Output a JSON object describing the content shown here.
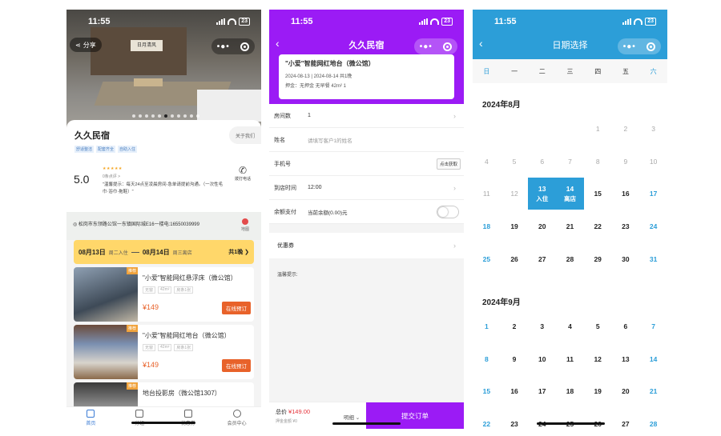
{
  "status": {
    "time": "11:55",
    "battery": "23"
  },
  "screen1": {
    "share_label": "分享",
    "hero_sign": "日月清风",
    "hotel_name": "久久民宿",
    "tags": [
      "舒适整洁",
      "配套齐全",
      "自助入住"
    ],
    "about_label": "关于我们",
    "score": "5.0",
    "stars": "★★★★★",
    "reviews": "0条点评 >",
    "notice": "\"温馨提示：每天24点至凌晨房间-急单请提前沟通。（一次性毛巾·浴巾·拖鞋）\"",
    "call_label": "拨打电话",
    "address": "◎ 松岗市东领路公馆一东镇国际城E16一楼电:16550039999",
    "map_label": "地图",
    "date_bar": {
      "checkin": "08月13日",
      "checkin_day": "周二入住",
      "checkout": "08月14日",
      "checkout_day": "周三离店",
      "nights": "共1晚 ❯"
    },
    "rooms": [
      {
        "badge": "推荐",
        "name": "\"小爱\"智能网红悬浮床（微公馆）",
        "specs": [
          "无窗",
          "42m²",
          "房条1张"
        ],
        "price": "¥149",
        "book": "在线预订"
      },
      {
        "badge": "推荐",
        "name": "\"小爱\"智能网红地台（微公馆）",
        "specs": [
          "无窗",
          "42m²",
          "房条1张"
        ],
        "price": "¥149",
        "book": "在线预订"
      },
      {
        "badge": "推荐",
        "name": "地台投影房（微公馆1307）",
        "specs": [],
        "price": "",
        "book": ""
      }
    ],
    "tabs": [
      "首页",
      "分组",
      "优惠券",
      "会员中心"
    ]
  },
  "screen2": {
    "title": "久久民宿",
    "booking": {
      "room": "\"小爱\"智能网红地台（微公馆）",
      "dates": "2024-08-13 | 2024-08-14 共1晚",
      "deposit": "押金：无押金  无早餐  42m²  1"
    },
    "form": {
      "rooms_label": "房间数",
      "rooms_value": "1",
      "name_label": "姓名",
      "name_placeholder": "请填写客户1的姓名",
      "phone_label": "手机号",
      "getcode": "点击获取",
      "arrive_label": "到店时间",
      "arrive_value": "12:00",
      "balance_label": "余额支付",
      "balance_value": "当前余额(0.00)元"
    },
    "coupon_label": "优惠券",
    "remind_label": "温馨提示:",
    "total_label": "总价",
    "total_value": "¥149.00",
    "deposit_note": "押金金额 ¥0",
    "detail_label": "明细 ⌄",
    "submit_label": "提交订单"
  },
  "screen3": {
    "title": "日期选择",
    "weekdays": [
      "日",
      "一",
      "二",
      "三",
      "四",
      "五",
      "六"
    ],
    "months": [
      {
        "title": "2024年8月",
        "first_weekday": 4,
        "days": 31,
        "past_until": 12,
        "selected": [
          13,
          14
        ],
        "sel_sub": {
          "13": "入住",
          "14": "离店"
        }
      },
      {
        "title": "2024年9月",
        "first_weekday": 0,
        "days": 28,
        "past_until": 0,
        "selected": [],
        "sel_sub": {}
      }
    ]
  },
  "colors": {
    "purple": "#9b1bf5",
    "blue": "#2c9ed8",
    "orange": "#e8622a",
    "yellow": "#ffd76a"
  }
}
